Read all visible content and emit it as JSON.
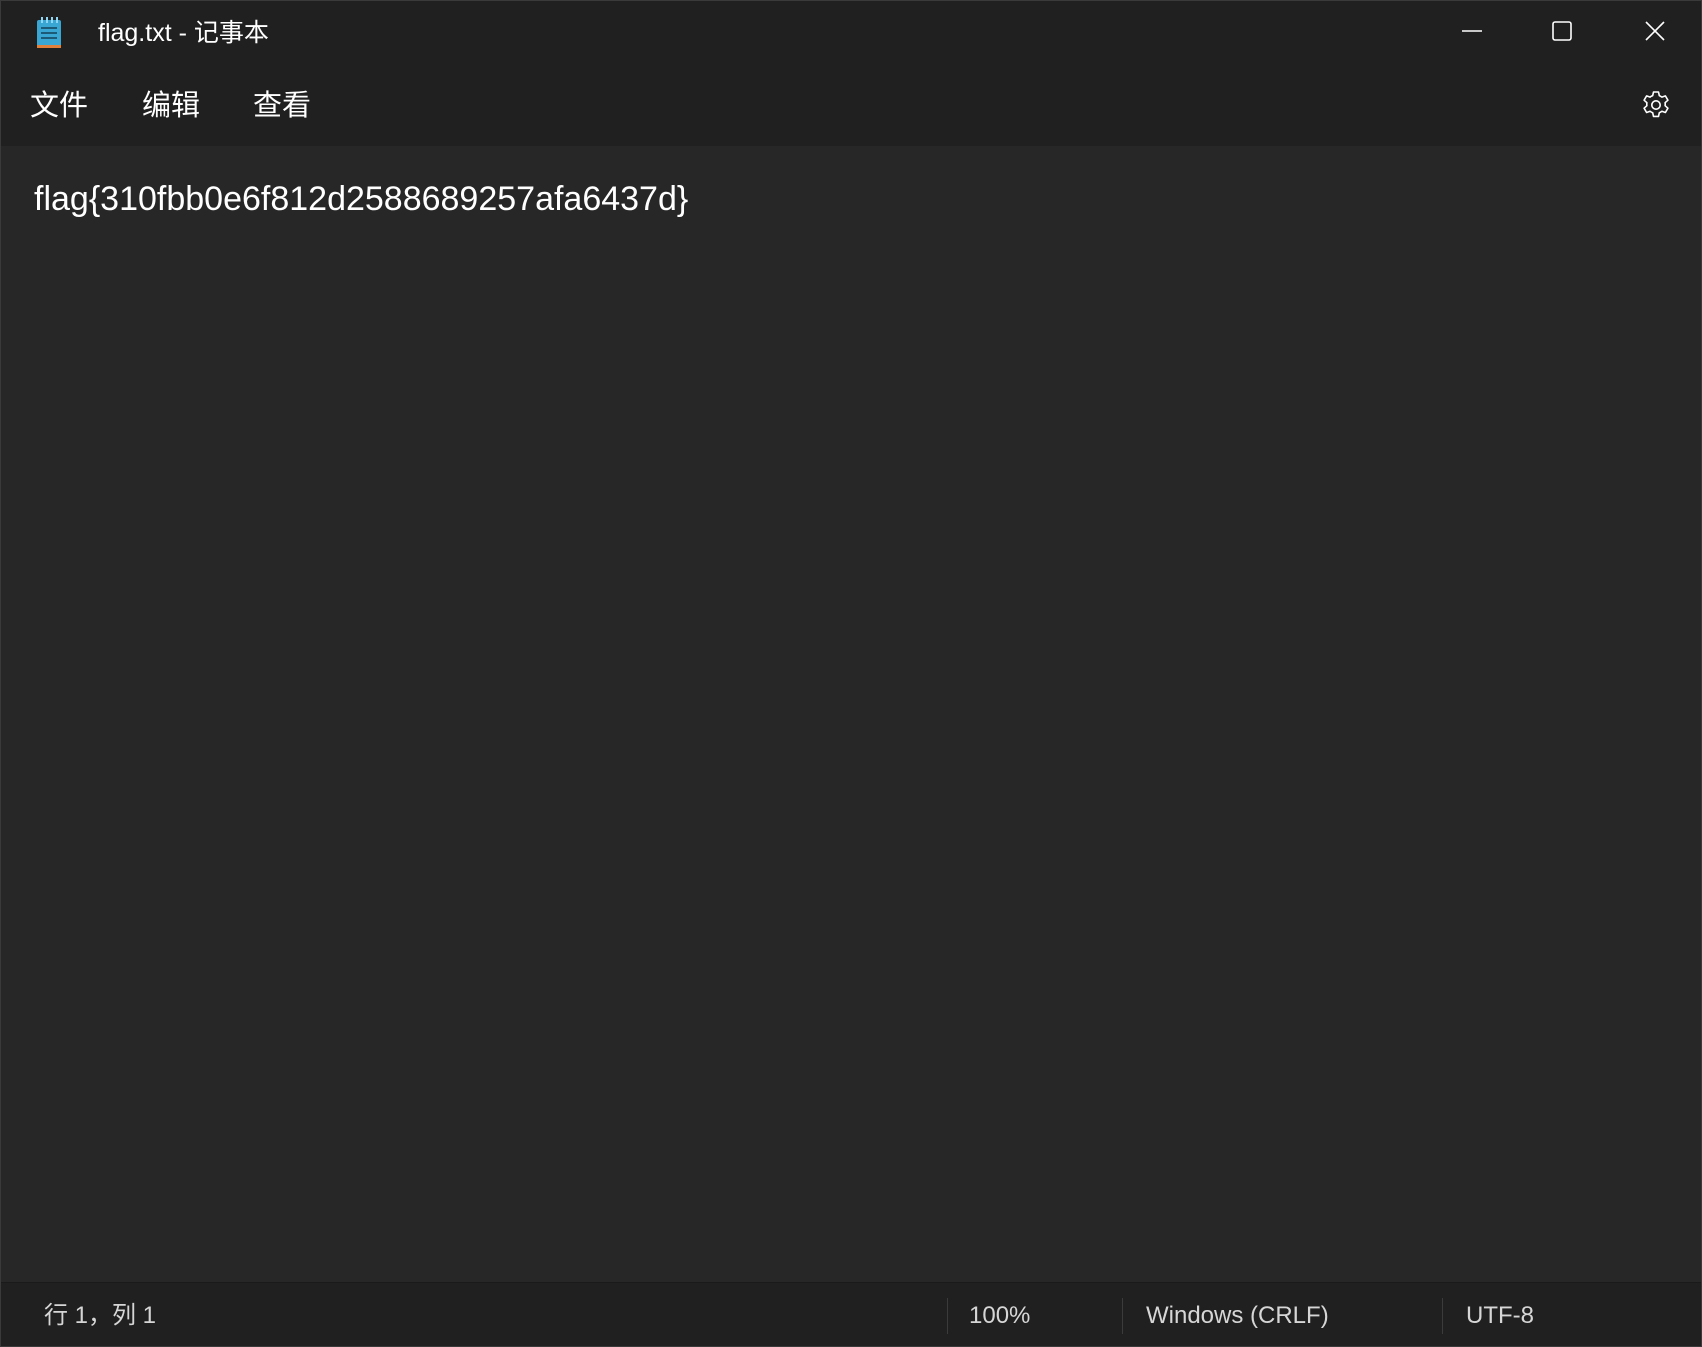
{
  "window": {
    "title": "flag.txt - 记事本",
    "app_icon": "notepad-icon",
    "controls": {
      "minimize_icon": "minimize-icon",
      "maximize_icon": "maximize-icon",
      "close_icon": "close-icon"
    }
  },
  "menu": {
    "items": [
      {
        "label": "文件"
      },
      {
        "label": "编辑"
      },
      {
        "label": "查看"
      }
    ],
    "settings_icon": "gear-icon"
  },
  "editor": {
    "content": "flag{310fbb0e6f812d2588689257afa6437d}"
  },
  "statusbar": {
    "position": "行 1，列 1",
    "zoom": "100%",
    "line_ending": "Windows (CRLF)",
    "encoding": "UTF-8"
  },
  "colors": {
    "titlebar_bg": "#202020",
    "editor_bg": "#272727",
    "text": "#ffffff",
    "icon_accent": "#4fc3f7"
  }
}
